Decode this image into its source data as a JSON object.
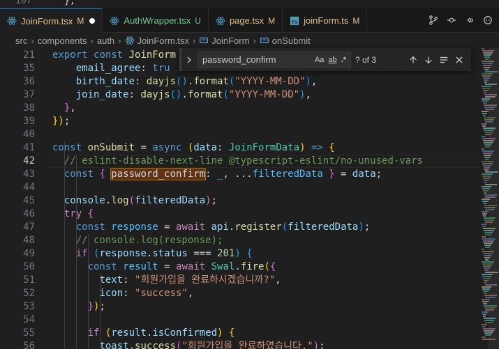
{
  "top_sliver": {
    "line_number": "107",
    "code": "},"
  },
  "tabs": [
    {
      "label": "JoinForm.tsx",
      "badge": "M",
      "dirty": true,
      "icon": "react-icon",
      "active": true,
      "status": "modified"
    },
    {
      "label": "AuthWrapper.tsx",
      "badge": "U",
      "dirty": false,
      "icon": "react-icon",
      "active": false,
      "status": "untracked"
    },
    {
      "label": "page.tsx",
      "badge": "M",
      "dirty": false,
      "icon": "react-icon",
      "active": false,
      "status": "modified"
    },
    {
      "label": "joinForm.ts",
      "badge": "M",
      "dirty": false,
      "icon": "ts-icon",
      "active": false,
      "status": "modified"
    }
  ],
  "breadcrumb": {
    "items": [
      "src",
      "components",
      "auth",
      "JoinForm.tsx",
      "JoinForm",
      "onSubmit"
    ]
  },
  "find": {
    "query": "password_confirm",
    "match_case": "Aa",
    "whole_word": "ab",
    "regex": ".*",
    "count": "? of 3"
  },
  "code_lines": [
    {
      "n": "21",
      "tokens": [
        [
          "kw",
          "export "
        ],
        [
          "kw",
          "const "
        ],
        [
          "fn",
          "JoinForm"
        ]
      ]
    },
    {
      "n": "35",
      "tokens": [
        [
          "var",
          "email_agree"
        ],
        [
          "pl",
          ": "
        ],
        [
          "kw",
          "tru"
        ]
      ]
    },
    {
      "n": "36",
      "tokens": [
        [
          "var",
          "birth_date"
        ],
        [
          "pl",
          ": "
        ],
        [
          "fn",
          "dayjs"
        ],
        [
          "br3",
          "()"
        ],
        [
          "pl",
          "."
        ],
        [
          "fn",
          "format"
        ],
        [
          "br3",
          "("
        ],
        [
          "str",
          "\"YYYY-MM-DD\""
        ],
        [
          "br3",
          ")"
        ],
        [
          "pl",
          ","
        ]
      ]
    },
    {
      "n": "37",
      "tokens": [
        [
          "var",
          "join_date"
        ],
        [
          "pl",
          ": "
        ],
        [
          "fn",
          "dayjs"
        ],
        [
          "br3",
          "()"
        ],
        [
          "pl",
          "."
        ],
        [
          "fn",
          "format"
        ],
        [
          "br3",
          "("
        ],
        [
          "str",
          "\"YYYY-MM-DD\""
        ],
        [
          "br3",
          ")"
        ],
        [
          "pl",
          ","
        ]
      ]
    },
    {
      "n": "38",
      "tokens": [
        [
          "br2",
          "}"
        ],
        [
          "pl",
          ","
        ]
      ]
    },
    {
      "n": "39",
      "tokens": [
        [
          "br1",
          "})"
        ],
        [
          "pl",
          ";"
        ]
      ]
    },
    {
      "n": "40",
      "tokens": []
    },
    {
      "n": "41",
      "tokens": [
        [
          "kw",
          "const "
        ],
        [
          "fn",
          "onSubmit"
        ],
        [
          "pl",
          " = "
        ],
        [
          "kw",
          "async "
        ],
        [
          "br1",
          "("
        ],
        [
          "var",
          "data"
        ],
        [
          "pl",
          ": "
        ],
        [
          "typ",
          "JoinFormData"
        ],
        [
          "br1",
          ")"
        ],
        [
          "pl",
          " "
        ],
        [
          "kw",
          "=>"
        ],
        [
          "pl",
          " "
        ],
        [
          "br1",
          "{"
        ]
      ]
    },
    {
      "n": "42",
      "tokens": [
        [
          "cmt",
          "// eslint-disable-next-line @typescript-eslint/no-unused-vars"
        ]
      ]
    },
    {
      "n": "43",
      "tokens": [
        [
          "kw",
          "const "
        ],
        [
          "br2",
          "{ "
        ],
        [
          "hl",
          "password_confirm"
        ],
        [
          "pl",
          ": "
        ],
        [
          "cst",
          "_"
        ],
        [
          "pl",
          ", ..."
        ],
        [
          "cst",
          "filteredData"
        ],
        [
          "br2",
          " }"
        ],
        [
          "pl",
          " = "
        ],
        [
          "var",
          "data"
        ],
        [
          "pl",
          ";"
        ]
      ]
    },
    {
      "n": "44",
      "tokens": []
    },
    {
      "n": "45",
      "tokens": [
        [
          "var",
          "console"
        ],
        [
          "pl",
          "."
        ],
        [
          "fn",
          "log"
        ],
        [
          "br2",
          "("
        ],
        [
          "var",
          "filteredData"
        ],
        [
          "br2",
          ")"
        ],
        [
          "pl",
          ";"
        ]
      ]
    },
    {
      "n": "46",
      "tokens": [
        [
          "ctl",
          "try "
        ],
        [
          "br2",
          "{"
        ]
      ]
    },
    {
      "n": "47",
      "tokens": [
        [
          "kw",
          "const "
        ],
        [
          "cst",
          "response"
        ],
        [
          "pl",
          " = "
        ],
        [
          "ctl",
          "await "
        ],
        [
          "var",
          "api"
        ],
        [
          "pl",
          "."
        ],
        [
          "fn",
          "register"
        ],
        [
          "br3",
          "("
        ],
        [
          "var",
          "filteredData"
        ],
        [
          "br3",
          ")"
        ],
        [
          "pl",
          ";"
        ]
      ]
    },
    {
      "n": "48",
      "tokens": [
        [
          "cmt",
          "// console.log(response);"
        ]
      ]
    },
    {
      "n": "49",
      "tokens": [
        [
          "ctl",
          "if "
        ],
        [
          "br3",
          "("
        ],
        [
          "var",
          "response"
        ],
        [
          "pl",
          "."
        ],
        [
          "var",
          "status"
        ],
        [
          "pl",
          " === "
        ],
        [
          "num-l",
          "201"
        ],
        [
          "br3",
          ")"
        ],
        [
          "pl",
          " "
        ],
        [
          "br3",
          "{"
        ]
      ]
    },
    {
      "n": "50",
      "tokens": [
        [
          "kw",
          "const "
        ],
        [
          "cst",
          "result"
        ],
        [
          "pl",
          " = "
        ],
        [
          "ctl",
          "await "
        ],
        [
          "typ",
          "Swal"
        ],
        [
          "pl",
          "."
        ],
        [
          "fn",
          "fire"
        ],
        [
          "br1",
          "("
        ],
        [
          "br2",
          "{"
        ]
      ]
    },
    {
      "n": "51",
      "tokens": [
        [
          "var",
          "text"
        ],
        [
          "pl",
          ": "
        ],
        [
          "str",
          "\"회원가입을 완료하시겠습니까?\""
        ],
        [
          "pl",
          ","
        ]
      ]
    },
    {
      "n": "52",
      "tokens": [
        [
          "var",
          "icon"
        ],
        [
          "pl",
          ": "
        ],
        [
          "str",
          "\"success\""
        ],
        [
          "pl",
          ","
        ]
      ]
    },
    {
      "n": "53",
      "tokens": [
        [
          "br2",
          "}"
        ],
        [
          "br1",
          ")"
        ],
        [
          "pl",
          ";"
        ]
      ]
    },
    {
      "n": "54",
      "tokens": []
    },
    {
      "n": "55",
      "tokens": [
        [
          "ctl",
          "if "
        ],
        [
          "br1",
          "("
        ],
        [
          "var",
          "result"
        ],
        [
          "pl",
          "."
        ],
        [
          "var",
          "isConfirmed"
        ],
        [
          "br1",
          ")"
        ],
        [
          "pl",
          " "
        ],
        [
          "br1",
          "{"
        ]
      ]
    },
    {
      "n": "56",
      "tokens": [
        [
          "var",
          "toast"
        ],
        [
          "pl",
          "."
        ],
        [
          "fn",
          "success"
        ],
        [
          "br2",
          "("
        ],
        [
          "str",
          "\"회원가입을 완료하였습니다.\""
        ],
        [
          "br2",
          ")"
        ],
        [
          "pl",
          ";"
        ]
      ]
    }
  ],
  "current_line": "42"
}
